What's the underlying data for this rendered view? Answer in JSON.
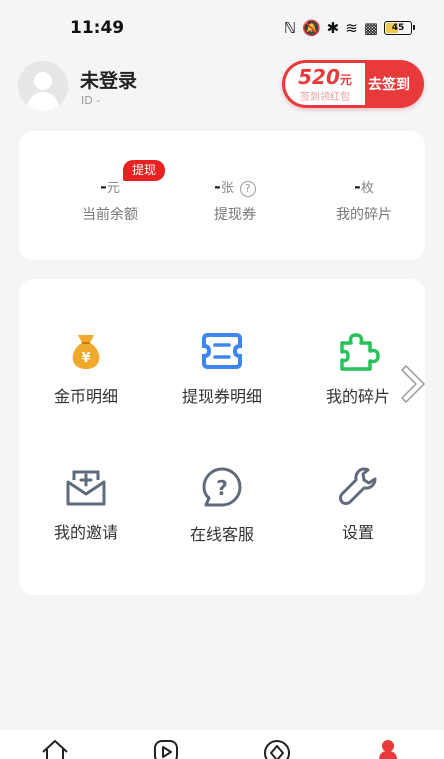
{
  "status_bar": {
    "time": "11:49",
    "battery": "45"
  },
  "profile": {
    "name": "未登录",
    "id": "ID -"
  },
  "signin": {
    "amount": "520",
    "unit": "元",
    "sub": "签到领红包",
    "button": "去签到"
  },
  "wallet": {
    "tag": "提现",
    "stats": [
      {
        "value": "-",
        "unit": "元",
        "label": "当前余额"
      },
      {
        "value": "-",
        "unit": "张",
        "label": "提现券"
      },
      {
        "value": "-",
        "unit": "枚",
        "label": "我的碎片"
      }
    ]
  },
  "grid": {
    "items": [
      {
        "label": "金币明细",
        "icon": "money-bag-icon"
      },
      {
        "label": "提现券明细",
        "icon": "coupon-icon"
      },
      {
        "label": "我的碎片",
        "icon": "puzzle-icon"
      },
      {
        "label": "我的邀请",
        "icon": "invite-envelope-icon"
      },
      {
        "label": "在线客服",
        "icon": "customer-service-icon"
      },
      {
        "label": "设置",
        "icon": "wrench-icon"
      }
    ]
  },
  "bottom_nav": {
    "items": [
      "home-icon",
      "play-icon",
      "discover-icon",
      "profile-icon"
    ]
  },
  "colors": {
    "accent": "#e83a3a",
    "gold": "#f0a92a",
    "blue": "#3d86f0",
    "green": "#27c25a",
    "gray_icon": "#5f6b7a"
  }
}
